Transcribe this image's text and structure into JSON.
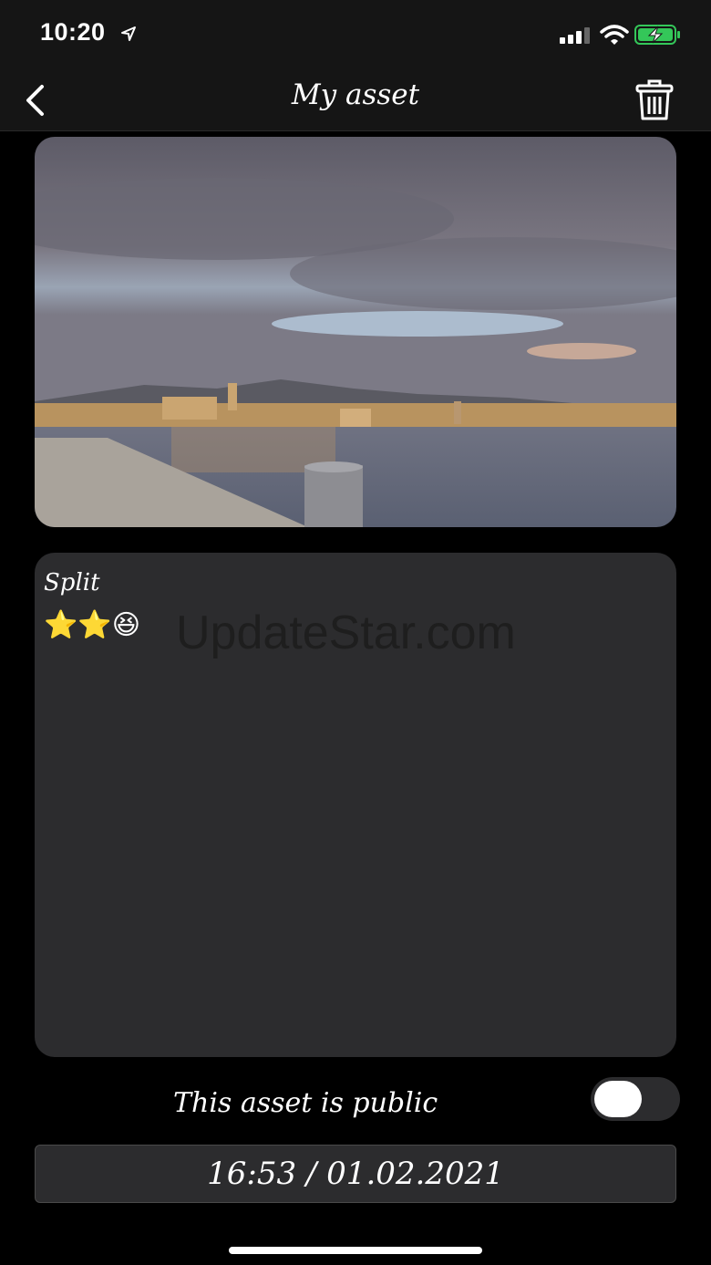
{
  "status_bar": {
    "time": "10:20"
  },
  "nav": {
    "title": "My asset"
  },
  "note": {
    "title": "Split",
    "body": "⭐⭐😆",
    "watermark": "UpdateStar.com"
  },
  "visibility": {
    "label": "This asset is public",
    "is_public": false
  },
  "timestamp": {
    "value": "16:53 / 01.02.2021"
  },
  "colors": {
    "background": "#000000",
    "bar": "#151515",
    "card": "#2c2c2e",
    "text": "#ffffff",
    "battery": "#34c759"
  }
}
